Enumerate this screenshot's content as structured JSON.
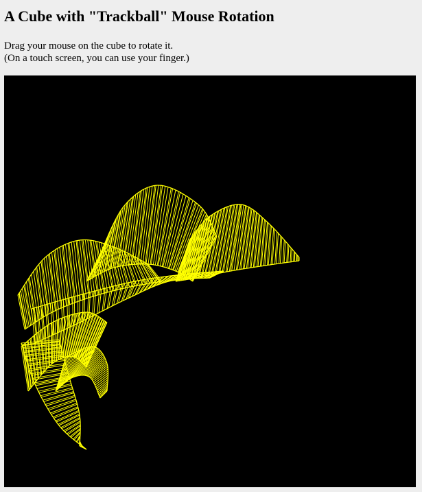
{
  "page": {
    "title": "A Cube with \"Trackball\" Mouse Rotation",
    "instructions_line1": "Drag your mouse on the cube to rotate it.",
    "instructions_line2": "(On a touch screen, you can use your finger.)"
  },
  "canvas": {
    "background_color": "#000000",
    "line_color": "#ffff00"
  }
}
